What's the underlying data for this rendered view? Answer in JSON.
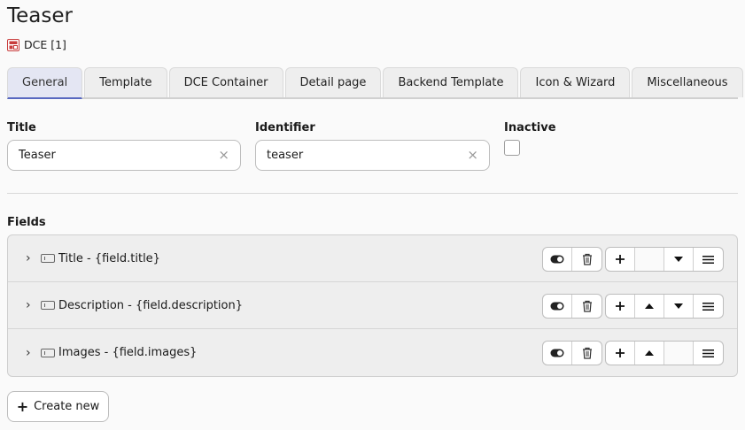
{
  "page": {
    "title": "Teaser"
  },
  "record": {
    "label": "DCE [1]",
    "icon": "record-icon",
    "accent": "#c83c3c"
  },
  "tabs": [
    {
      "label": "General",
      "active": true
    },
    {
      "label": "Template"
    },
    {
      "label": "DCE Container"
    },
    {
      "label": "Detail page"
    },
    {
      "label": "Backend Template"
    },
    {
      "label": "Icon & Wizard"
    },
    {
      "label": "Miscellaneous"
    }
  ],
  "form": {
    "title_label": "Title",
    "title_value": "Teaser",
    "identifier_label": "Identifier",
    "identifier_value": "teaser",
    "inactive_label": "Inactive",
    "inactive_checked": false,
    "clear_glyph": "×"
  },
  "fields": {
    "heading": "Fields",
    "rows": [
      {
        "text": "Title - {field.title}"
      },
      {
        "text": "Description - {field.description}"
      },
      {
        "text": "Images - {field.images}"
      }
    ]
  },
  "create": {
    "label": "Create new",
    "icon": "plus-icon"
  },
  "colors": {
    "tab_active_bg": "#e4e6f3",
    "tab_active_border": "#5868c0"
  }
}
